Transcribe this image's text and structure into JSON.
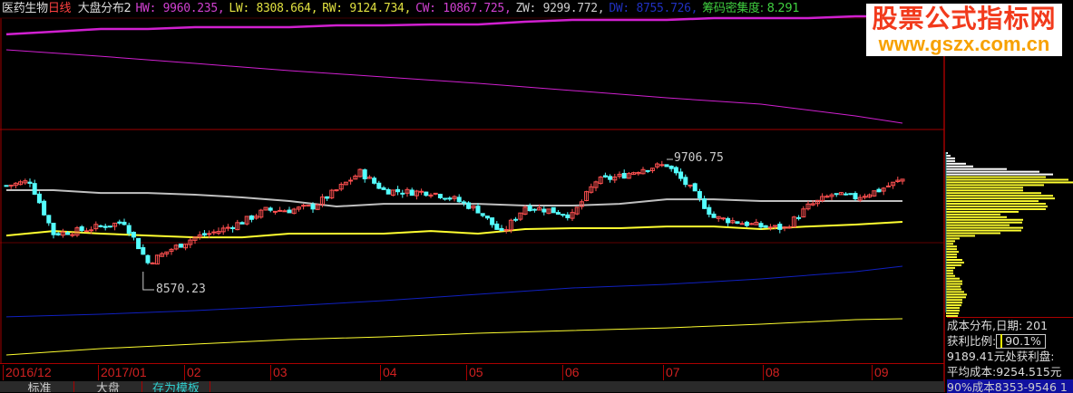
{
  "header": {
    "stock": "医药生物",
    "period": "日线",
    "indicator": "大盘分布2",
    "items": [
      {
        "text": "HW: 9960.235,",
        "color": "#d040d0"
      },
      {
        "text": "LW: 8308.664,",
        "color": "#e0e040"
      },
      {
        "text": "RW: 9124.734,",
        "color": "#e0e040"
      },
      {
        "text": "CW: 10867.725,",
        "color": "#d040d0"
      },
      {
        "text": "ZW: 9299.772,",
        "color": "#cccccc"
      },
      {
        "text": "DW: 8755.726,",
        "color": "#2030c0"
      },
      {
        "text": "筹码密集度: 8.291",
        "color": "#40d040"
      }
    ]
  },
  "logo": {
    "line1": "股票公式指标网",
    "line2": "www.gszx.com.cn"
  },
  "annotations": {
    "high": "9706.75",
    "low": "8570.23"
  },
  "info_panel": {
    "title": "成本分布,日期: 201",
    "profit_label": "获利比例:",
    "profit_value": "90.1%",
    "profit_at": "9189.41元处获利盘:",
    "avg_cost": "平均成本:9254.515元",
    "range90": "90%成本8353-9546 1"
  },
  "x_axis": [
    "2016/12",
    "2017/01",
    "02",
    "03",
    "04",
    "05",
    "06",
    "07",
    "08",
    "09"
  ],
  "tabs": [
    "标准",
    "大盘",
    "存为模板"
  ],
  "colors": {
    "up": "#ff5050",
    "down": "#54ffff",
    "grid": "#a00000",
    "magenta": "#d020d0",
    "gray": "#c0c0c0",
    "yellow": "#ffff30",
    "blue": "#1020c0",
    "profit_bar": "#ffff30",
    "loss_bar": "#ffffff"
  },
  "chart_data": {
    "type": "candlestick",
    "ylim": [
      7653,
      11321
    ],
    "candle_count": 191,
    "high_marker": 9706.75,
    "low_marker": 8570.23,
    "close_keypoints_every_5": [
      9441,
      9487,
      8955,
      8982,
      9028,
      9074,
      8661,
      8799,
      8918,
      8982,
      9074,
      9193,
      9193,
      9230,
      9395,
      9578,
      9395,
      9377,
      9377,
      9303,
      9193,
      8955,
      9230,
      9193,
      9138,
      9487,
      9533,
      9615,
      9652,
      9413,
      9120,
      9074,
      9028,
      9010,
      9230,
      9349,
      9322,
      9395,
      9505
    ],
    "lines": [
      {
        "name": "HW-top",
        "color": "magenta",
        "width": 2.5,
        "step": 10,
        "values": [
          10973,
          11000,
          11028,
          11028,
          11046,
          11046,
          11046,
          11064,
          11064,
          11073,
          11073,
          11101,
          11119,
          11119,
          11119,
          11138,
          11138,
          11138,
          11156,
          11156
        ]
      },
      {
        "name": "CW",
        "color": "magenta",
        "width": 1,
        "step": 20,
        "values": [
          10817,
          10752,
          10679,
          10606,
          10542,
          10477,
          10404,
          10331,
          10266,
          10147,
          10074
        ]
      },
      {
        "name": "ZW",
        "color": "gray",
        "width": 2,
        "step": 10,
        "values": [
          9395,
          9395,
          9367,
          9367,
          9349,
          9322,
          9285,
          9230,
          9257,
          9257,
          9257,
          9239,
          9239,
          9257,
          9303,
          9303,
          9285,
          9285,
          9285,
          9285
        ]
      },
      {
        "name": "RW",
        "color": "yellow",
        "width": 2,
        "step": 10,
        "values": [
          8936,
          8982,
          8955,
          8936,
          8918,
          8918,
          8955,
          8955,
          8955,
          8982,
          8955,
          9001,
          9010,
          9010,
          9028,
          9028,
          9001,
          9028,
          9047,
          9074
        ]
      },
      {
        "name": "DW",
        "color": "blue",
        "width": 1,
        "step": 20,
        "values": [
          8112,
          8139,
          8176,
          8222,
          8277,
          8341,
          8405,
          8442,
          8497,
          8570,
          8625
        ]
      },
      {
        "name": "LW",
        "color": "yellow",
        "width": 1,
        "step": 20,
        "values": [
          7726,
          7791,
          7836,
          7882,
          7910,
          7946,
          7974,
          8001,
          8038,
          8084,
          8093
        ]
      }
    ],
    "cost_distribution": {
      "profit_split_index": 9,
      "values": [
        2,
        5,
        10,
        10,
        22,
        30,
        67,
        103,
        118,
        110,
        135,
        140,
        108,
        85,
        85,
        105,
        118,
        120,
        102,
        110,
        112,
        110,
        80,
        60,
        67,
        85,
        84,
        70,
        85,
        83,
        60,
        32,
        15,
        10,
        8,
        12,
        12,
        14,
        12,
        12,
        18,
        20,
        17,
        10,
        8,
        8,
        10,
        15,
        18,
        18,
        16,
        17,
        20,
        23,
        22,
        18,
        18,
        17,
        15,
        15,
        14,
        13
      ]
    }
  }
}
